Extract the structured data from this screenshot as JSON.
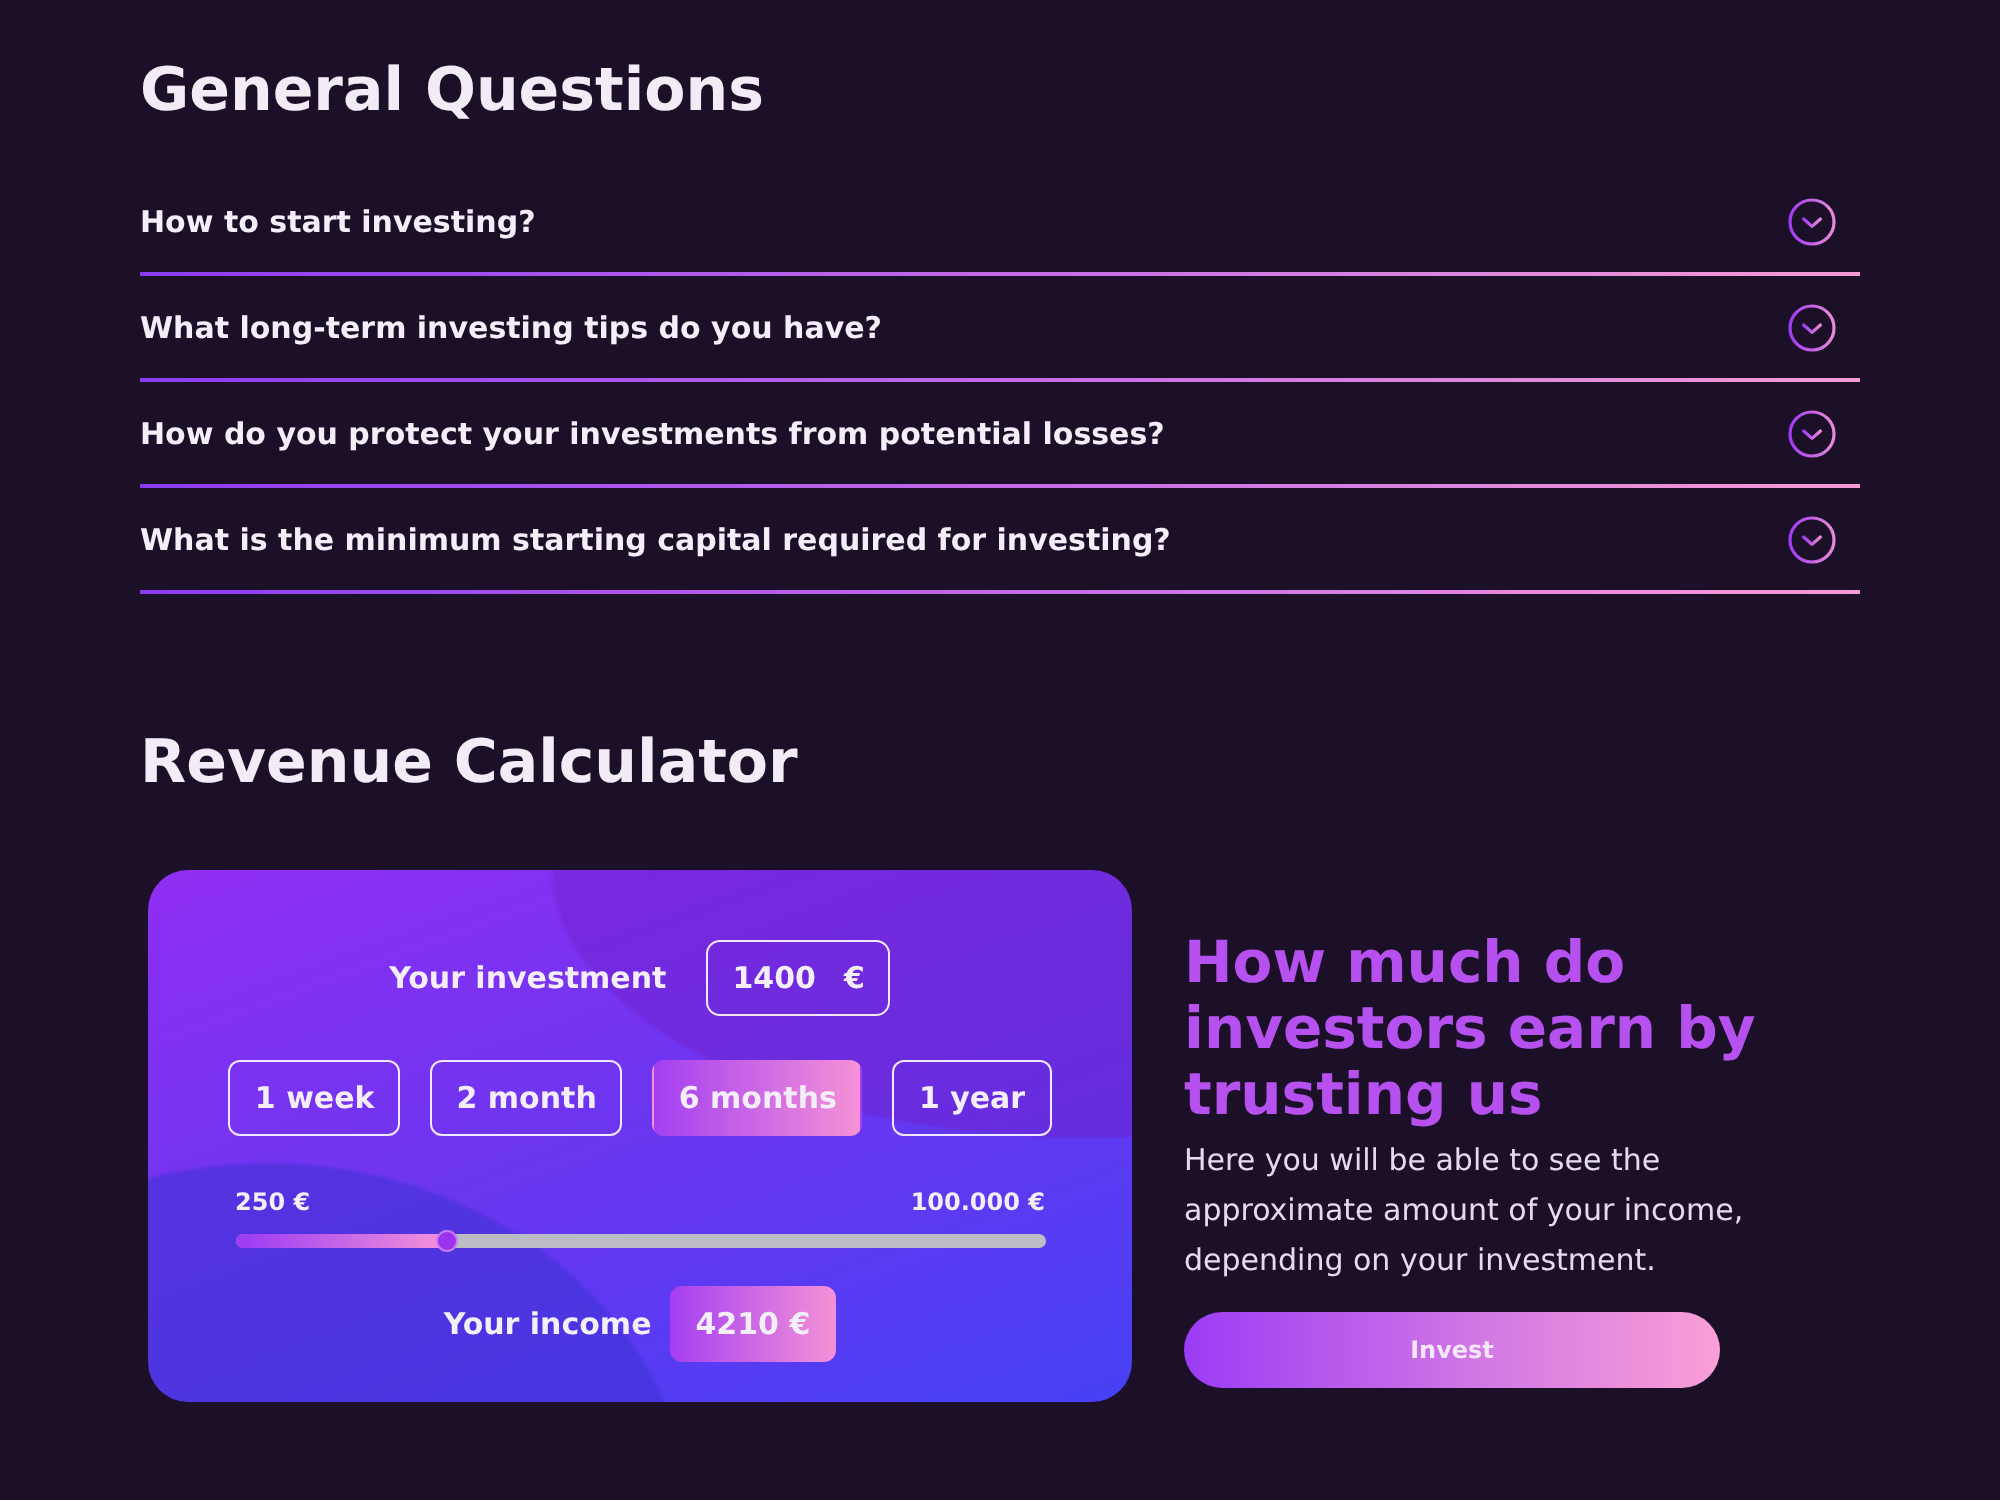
{
  "faq": {
    "title": "General Questions",
    "items": [
      {
        "question": "How to start investing?",
        "expanded": false
      },
      {
        "question": "What long-term investing tips do you have?",
        "expanded": false
      },
      {
        "question": "How do you protect your investments from potential losses?",
        "expanded": false
      },
      {
        "question": "What is the minimum starting capital required for investing?",
        "expanded": false
      }
    ]
  },
  "calculator": {
    "title": "Revenue Calculator",
    "investment": {
      "label": "Your investment",
      "value": "1400",
      "currency": "€"
    },
    "periods": [
      {
        "label": "1 week",
        "selected": false
      },
      {
        "label": "2 month",
        "selected": false
      },
      {
        "label": "6 months",
        "selected": true
      },
      {
        "label": "1 year",
        "selected": false
      }
    ],
    "range": {
      "min": "250 €",
      "max": "100.000 €",
      "level": 0.26
    },
    "income": {
      "label": "Your income",
      "value": "4210 €"
    }
  },
  "promo": {
    "heading": "How much do investors earn by trusting us",
    "text": "Here you will be able to see the approximate amount of your income, depending on your investment.",
    "button": "Invest"
  }
}
